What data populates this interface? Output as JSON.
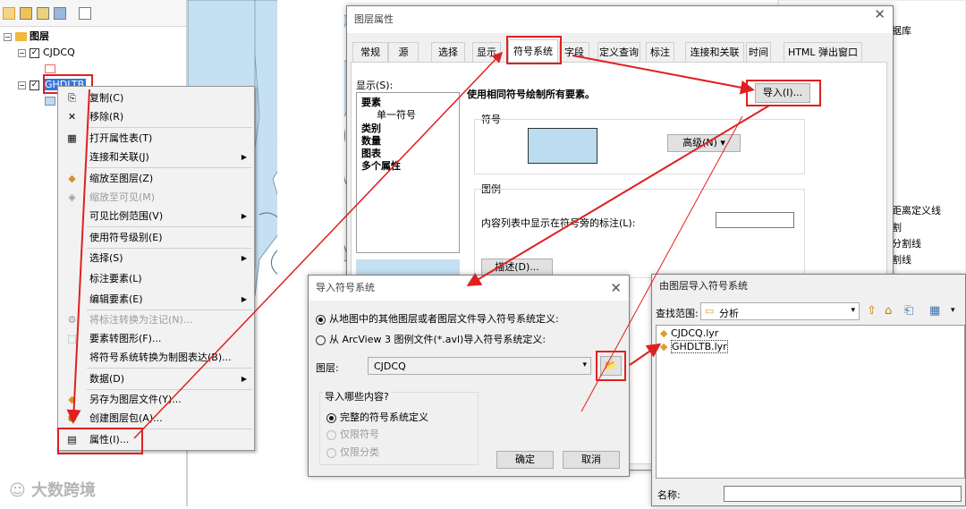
{
  "toc": {
    "root_label": "图层",
    "layer1": "CJDCQ",
    "layer2": "GHDLTB",
    "expand_minus": "⊟",
    "check": "✓"
  },
  "context_menu": {
    "items": [
      {
        "label": "复制(C)",
        "icon": "copy-icon",
        "disabled": false,
        "submenu": false
      },
      {
        "label": "移除(R)",
        "icon": "remove-icon",
        "disabled": false,
        "submenu": false
      },
      {
        "label": "打开属性表(T)",
        "icon": "table-icon",
        "disabled": false,
        "submenu": false
      },
      {
        "label": "连接和关联(J)",
        "icon": "",
        "disabled": false,
        "submenu": true
      },
      {
        "label": "缩放至图层(Z)",
        "icon": "zoom-layer-icon",
        "disabled": false,
        "submenu": false
      },
      {
        "label": "缩放至可见(M)",
        "icon": "zoom-visible-icon",
        "disabled": true,
        "submenu": false
      },
      {
        "label": "可见比例范围(V)",
        "icon": "",
        "disabled": false,
        "submenu": true
      },
      {
        "label": "使用符号级别(E)",
        "icon": "",
        "disabled": false,
        "submenu": false
      },
      {
        "label": "选择(S)",
        "icon": "",
        "disabled": false,
        "submenu": true
      },
      {
        "label": "标注要素(L)",
        "icon": "",
        "disabled": false,
        "submenu": false
      },
      {
        "label": "编辑要素(E)",
        "icon": "",
        "disabled": false,
        "submenu": true
      },
      {
        "label": "将标注转换为注记(N)...",
        "icon": "convert-label-icon",
        "disabled": true,
        "submenu": false
      },
      {
        "label": "要素转图形(F)...",
        "icon": "feature-graphic-icon",
        "disabled": false,
        "submenu": false
      },
      {
        "label": "将符号系统转换为制图表达(B)...",
        "icon": "",
        "disabled": false,
        "submenu": false
      },
      {
        "label": "数据(D)",
        "icon": "",
        "disabled": false,
        "submenu": true
      },
      {
        "label": "另存为图层文件(Y)...",
        "icon": "save-layer-icon",
        "disabled": false,
        "submenu": false
      },
      {
        "label": "创建图层包(A)...",
        "icon": "layer-package-icon",
        "disabled": false,
        "submenu": false
      },
      {
        "label": "属性(I)...",
        "icon": "properties-icon",
        "disabled": false,
        "submenu": false
      }
    ]
  },
  "layer_props": {
    "title": "图层属性",
    "close": "✕",
    "tabs": [
      "常规",
      "源",
      "选择",
      "显示",
      "符号系统",
      "字段",
      "定义查询",
      "标注",
      "连接和关联",
      "时间",
      "HTML 弹出窗口"
    ],
    "active_tab": "符号系统",
    "show_label": "显示(S):",
    "show_tree": [
      "要素",
      "单一符号",
      "类别",
      "数量",
      "图表",
      "多个属性"
    ],
    "heading": "使用相同符号绘制所有要素。",
    "import_btn": "导入(I)...",
    "symbol_group": "符号",
    "advanced_btn": "高级(N)",
    "legend_group": "图例",
    "legend_label": "内容列表中显示在符号旁的标注(L):",
    "describe_btn": "描述(D)...",
    "symbol_color": "#bcdcf0"
  },
  "import_dialog": {
    "title": "导入符号系统",
    "close": "✕",
    "opt1": "从地图中的其他图层或者图层文件导入符号系统定义:",
    "opt2": "从 ArcView 3 图例文件(*.avl)导入符号系统定义:",
    "layer_label": "图层:",
    "layer_value": "CJDCQ",
    "what_label": "导入哪些内容?",
    "what_opt1": "完整的符号系统定义",
    "what_opt2": "仅限符号",
    "what_opt3": "仅限分类",
    "ok": "确定",
    "cancel": "取消"
  },
  "file_dialog": {
    "title": "由图层导入符号系统",
    "look_in_label": "查找范围:",
    "look_in_value": "分析",
    "files": [
      "CJDCQ.lyr",
      "GHDLTB.lyr"
    ],
    "name_label": "名称:"
  },
  "right_panel": {
    "items": [
      "据库",
      "距离定义线",
      "割",
      "分割线",
      "割线"
    ]
  },
  "watermark": "大数跨境"
}
